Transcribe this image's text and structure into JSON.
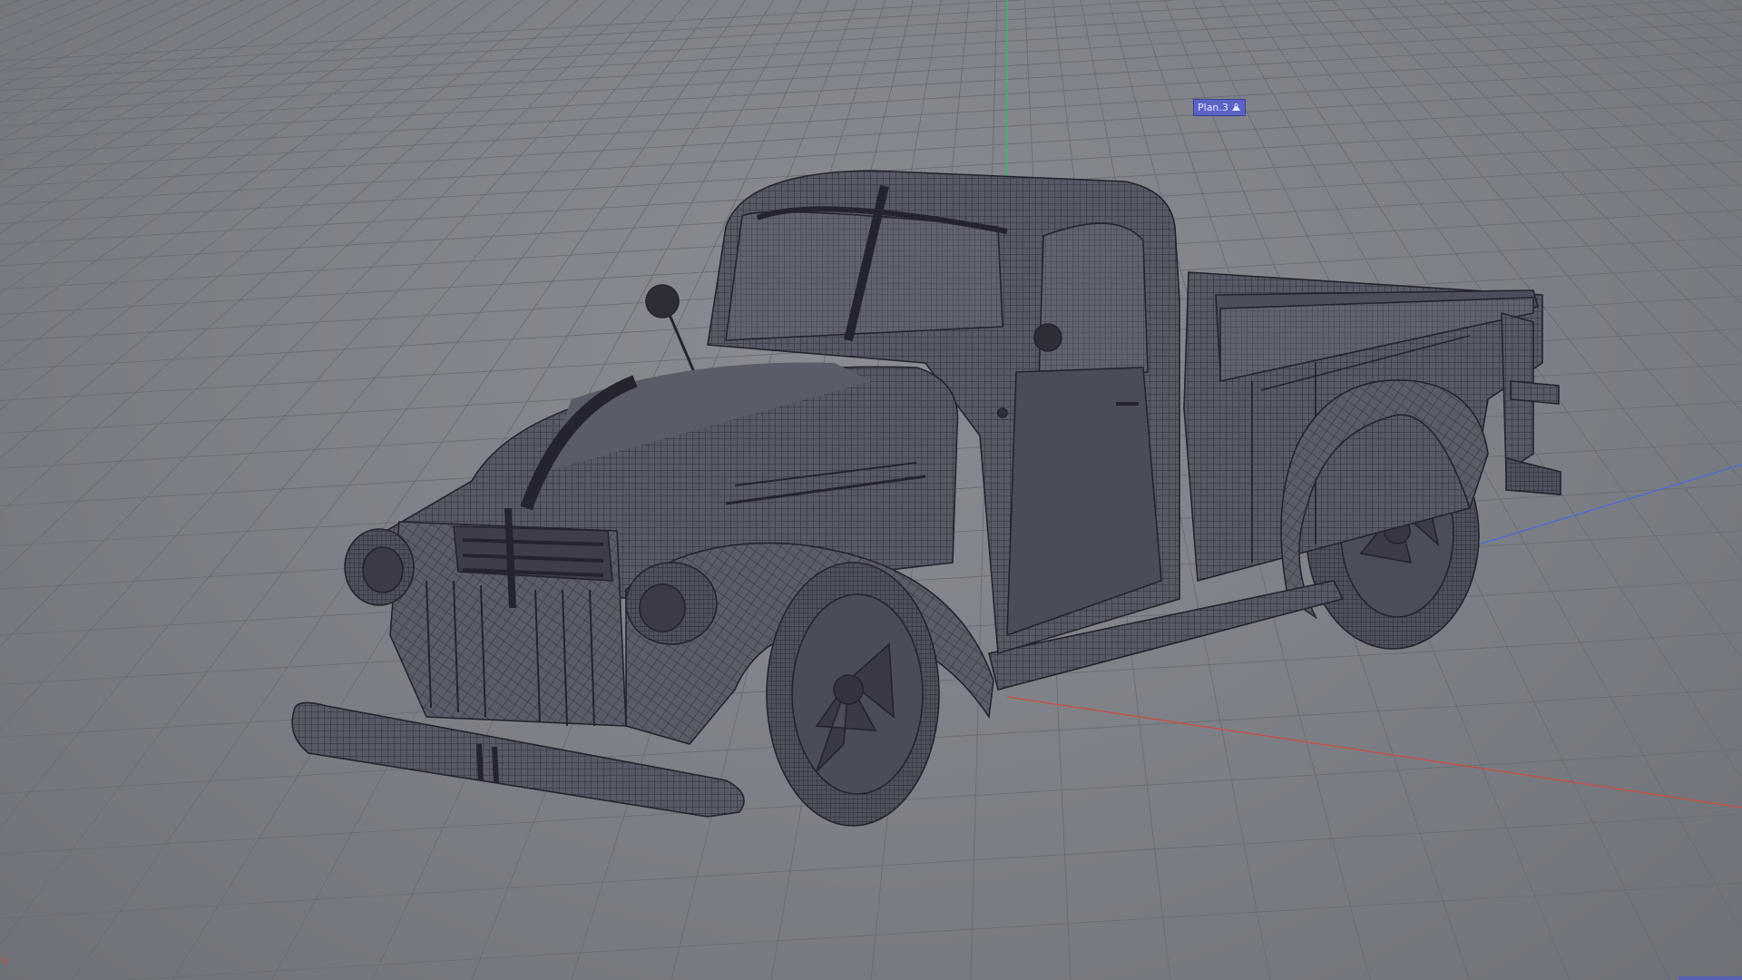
{
  "viewport": {
    "object_label": "Plan.3",
    "object_icon": "camera-target-icon",
    "axis_x_label": "X",
    "colors": {
      "background": "#7f8188",
      "grid": "#6a6c73",
      "wire": "#2c2d38",
      "axis_x": "#d04a3e",
      "axis_y": "#3bb56a",
      "axis_z": "#4a6ad8",
      "label_bg": "#5b62c4"
    }
  }
}
